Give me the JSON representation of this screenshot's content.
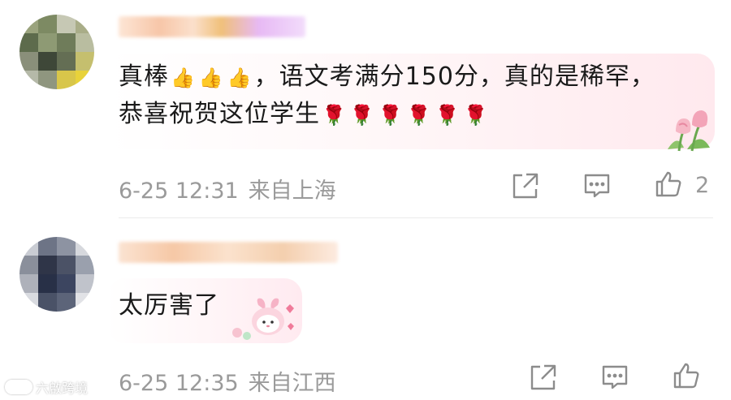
{
  "comments": [
    {
      "text_a": "真棒",
      "emoji_thumb": "👍",
      "text_b": "，语文考满分150分，真的是稀罕，恭喜祝贺这位学生",
      "emoji_rose": "🌹",
      "date": "6-25 12:31",
      "location": "来自上海",
      "like_count": "2"
    },
    {
      "text": "太厉害了",
      "date": "6-25 12:35",
      "location": "来自江西",
      "like_count": ""
    }
  ],
  "watermark": {
    "text": "六啟跨境"
  },
  "icons": [
    "share-icon",
    "comment-icon",
    "like-icon",
    "tulip-sticker",
    "bunny-sticker"
  ],
  "colors": {
    "meta_gray": "#9a9a9a",
    "text": "#1a1a1a",
    "bubble_pink": "#ffe9ee"
  }
}
